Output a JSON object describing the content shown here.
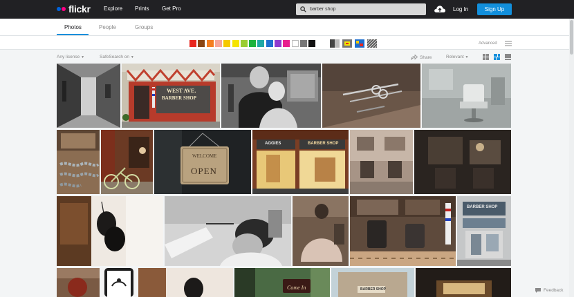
{
  "header": {
    "logo_text": "flickr",
    "nav": [
      "Explore",
      "Prints",
      "Get Pro"
    ],
    "search_value": "barber shop",
    "login": "Log In",
    "signup": "Sign Up"
  },
  "tabs": [
    "Photos",
    "People",
    "Groups"
  ],
  "color_swatches": [
    "#e8261e",
    "#8b4513",
    "#f47e20",
    "#f7a699",
    "#f5c900",
    "#f5e400",
    "#9acd32",
    "#1db33d",
    "#1fa8a5",
    "#1e6fcf",
    "#8e3acf",
    "#e81f8f",
    "#ffffff",
    "#777777",
    "#111111"
  ],
  "advanced_label": "Advanced",
  "filters": {
    "license": "Any license",
    "safesearch": "SafeSearch on",
    "share": "Share",
    "sort": "Relevant"
  },
  "feedback": "Feedback",
  "photo_overlays": {
    "sign_west": "WEST AVE.",
    "sign_barber": "BARBER SHOP",
    "sign_welcome": "WELCOME",
    "sign_open": "OPEN",
    "agency": "AGGIES",
    "barber_shop": "BARBER SHOP",
    "barber_shop_small": "BARBER SHOP",
    "come_in": "Come In"
  }
}
